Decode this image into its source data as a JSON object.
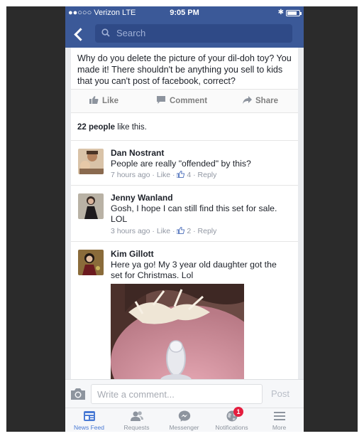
{
  "status_bar": {
    "carrier": "●●○○○ Verizon  LTE",
    "time": "9:05 PM"
  },
  "nav": {
    "search_placeholder": "Search"
  },
  "post": {
    "text": "Why do you delete the picture of your dil-doh toy? You made it! There shouldn't be anything you sell to kids that you can't post of facebook, correct?",
    "actions": {
      "like": "Like",
      "comment": "Comment",
      "share": "Share"
    },
    "likes": {
      "count": "22 people",
      "suffix": " like this."
    }
  },
  "comments": [
    {
      "name": "Dan Nostrant",
      "text": "People are really \"offended\" by this?",
      "time": "7 hours ago",
      "like": "Like",
      "like_count": "4",
      "reply": "Reply"
    },
    {
      "name": "Jenny Wanland",
      "text": "Gosh, I hope I can still find this set for sale. LOL",
      "time": "3 hours ago",
      "like": "Like",
      "like_count": "2",
      "reply": "Reply"
    },
    {
      "name": "Kim Gillott",
      "text": "Here ya go!  My 3 year old daughter got the set for Christmas.  Lol"
    }
  ],
  "composer": {
    "placeholder": "Write a comment...",
    "post_label": "Post"
  },
  "tabs": [
    {
      "label": "News Feed",
      "icon": "news-feed-icon",
      "active": true
    },
    {
      "label": "Requests",
      "icon": "friend-requests-icon"
    },
    {
      "label": "Messenger",
      "icon": "messenger-icon"
    },
    {
      "label": "Notifications",
      "icon": "globe-icon",
      "badge": "1"
    },
    {
      "label": "More",
      "icon": "menu-icon"
    }
  ],
  "colors": {
    "brand": "#3b5998",
    "active_tab": "#4a7ad4",
    "badge": "#e41e3f"
  }
}
